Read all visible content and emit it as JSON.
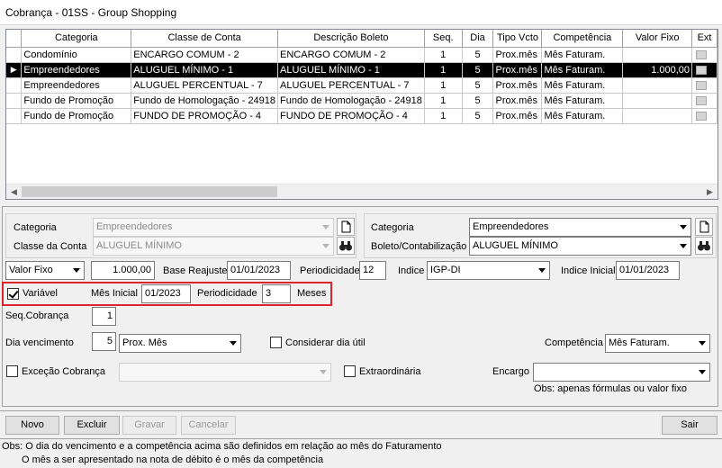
{
  "window": {
    "title": "Cobrança - 01SS - Group Shopping"
  },
  "grid": {
    "columns": [
      "Categoria",
      "Classe de Conta",
      "Descrição Boleto",
      "Seq.",
      "Dia",
      "Tipo Vcto",
      "Competência",
      "Valor Fixo",
      "Ext"
    ],
    "rows": [
      {
        "categoria": "Condomínio",
        "classe": "ENCARGO COMUM - 2",
        "descricao": "ENCARGO COMUM - 2",
        "seq": "1",
        "dia": "5",
        "tipo": "Prox.mês",
        "competencia": "Mês Faturam.",
        "valor": "",
        "selected": false
      },
      {
        "categoria": "Empreendedores",
        "classe": "ALUGUEL MÍNIMO - 1",
        "descricao": "ALUGUEL MÍNIMO - 1",
        "seq": "1",
        "dia": "5",
        "tipo": "Prox.mês",
        "competencia": "Mês Faturam.",
        "valor": "1.000,00",
        "selected": true,
        "indicator": "▶"
      },
      {
        "categoria": "Empreendedores",
        "classe": "ALUGUEL PERCENTUAL - 7",
        "descricao": "ALUGUEL PERCENTUAL - 7",
        "seq": "1",
        "dia": "5",
        "tipo": "Prox.mês",
        "competencia": "Mês Faturam.",
        "valor": "",
        "selected": false
      },
      {
        "categoria": "Fundo de Promoção",
        "classe": "Fundo de Homologação - 24918",
        "descricao": "Fundo de Homologação - 24918",
        "seq": "1",
        "dia": "5",
        "tipo": "Prox.mês",
        "competencia": "Mês Faturam.",
        "valor": "",
        "selected": false
      },
      {
        "categoria": "Fundo de Promoção",
        "classe": "FUNDO DE PROMOÇÃO - 4",
        "descricao": "FUNDO DE PROMOÇÃO - 4",
        "seq": "1",
        "dia": "5",
        "tipo": "Prox.mês",
        "competencia": "Mês Faturam.",
        "valor": "",
        "selected": false
      }
    ],
    "scroll_left_arrow": "◀",
    "scroll_right_arrow": "▶"
  },
  "form": {
    "left_group": {
      "categoria_label": "Categoria",
      "categoria_value": "Empreendedores",
      "classe_label": "Classe da Conta",
      "classe_value": "ALUGUEL MÍNIMO"
    },
    "right_group": {
      "categoria_label": "Categoria",
      "categoria_value": "Empreendedores",
      "boleto_label": "Boleto/Contabilização",
      "boleto_value": "ALUGUEL MÍNIMO"
    },
    "valor_tipo": "Valor Fixo",
    "valor": "1.000,00",
    "base_reajuste_label": "Base Reajuste",
    "base_reajuste": "01/01/2023",
    "periodicidade_label": "Periodicidade",
    "periodicidade": "12",
    "indice_label": "Indice",
    "indice": "IGP-DI",
    "indice_inicial_label": "Indice Inicial",
    "indice_inicial": "01/01/2023",
    "variavel_label": "Variável",
    "variavel_checked": true,
    "mes_inicial_label": "Mês Inicial",
    "mes_inicial": "01/2023",
    "periodicidade2_label": "Periodicidade",
    "periodicidade2": "3",
    "meses_label": "Meses",
    "seq_cobranca_label": "Seq.Cobrança",
    "seq_cobranca": "1",
    "dia_vencimento_label": "Dia vencimento",
    "dia_vencimento": "5",
    "tipo_vencimento": "Prox. Mês",
    "considerar_dia_util_label": "Considerar dia útil",
    "competencia_label": "Competência",
    "competencia": "Mês Faturam.",
    "excecao_label": "Exceção Cobrança",
    "excecao_value": "",
    "extraordinaria_label": "Extraordinária",
    "encargo_label": "Encargo",
    "encargo_value": "",
    "obs_formula": "Obs: apenas fórmulas ou valor fixo"
  },
  "buttons": {
    "novo": "Novo",
    "excluir": "Excluir",
    "gravar": "Gravar",
    "cancelar": "Cancelar",
    "sair": "Sair"
  },
  "footer": {
    "line1": "Obs: O dia do vencimento e a competência acima são definidos em relação ao mês do Faturamento",
    "line2": "O mês a ser apresentado na nota de débito é o mês da competência"
  },
  "colors": {
    "highlight_box": "#e0242f",
    "selected_row_bg": "#000000"
  }
}
